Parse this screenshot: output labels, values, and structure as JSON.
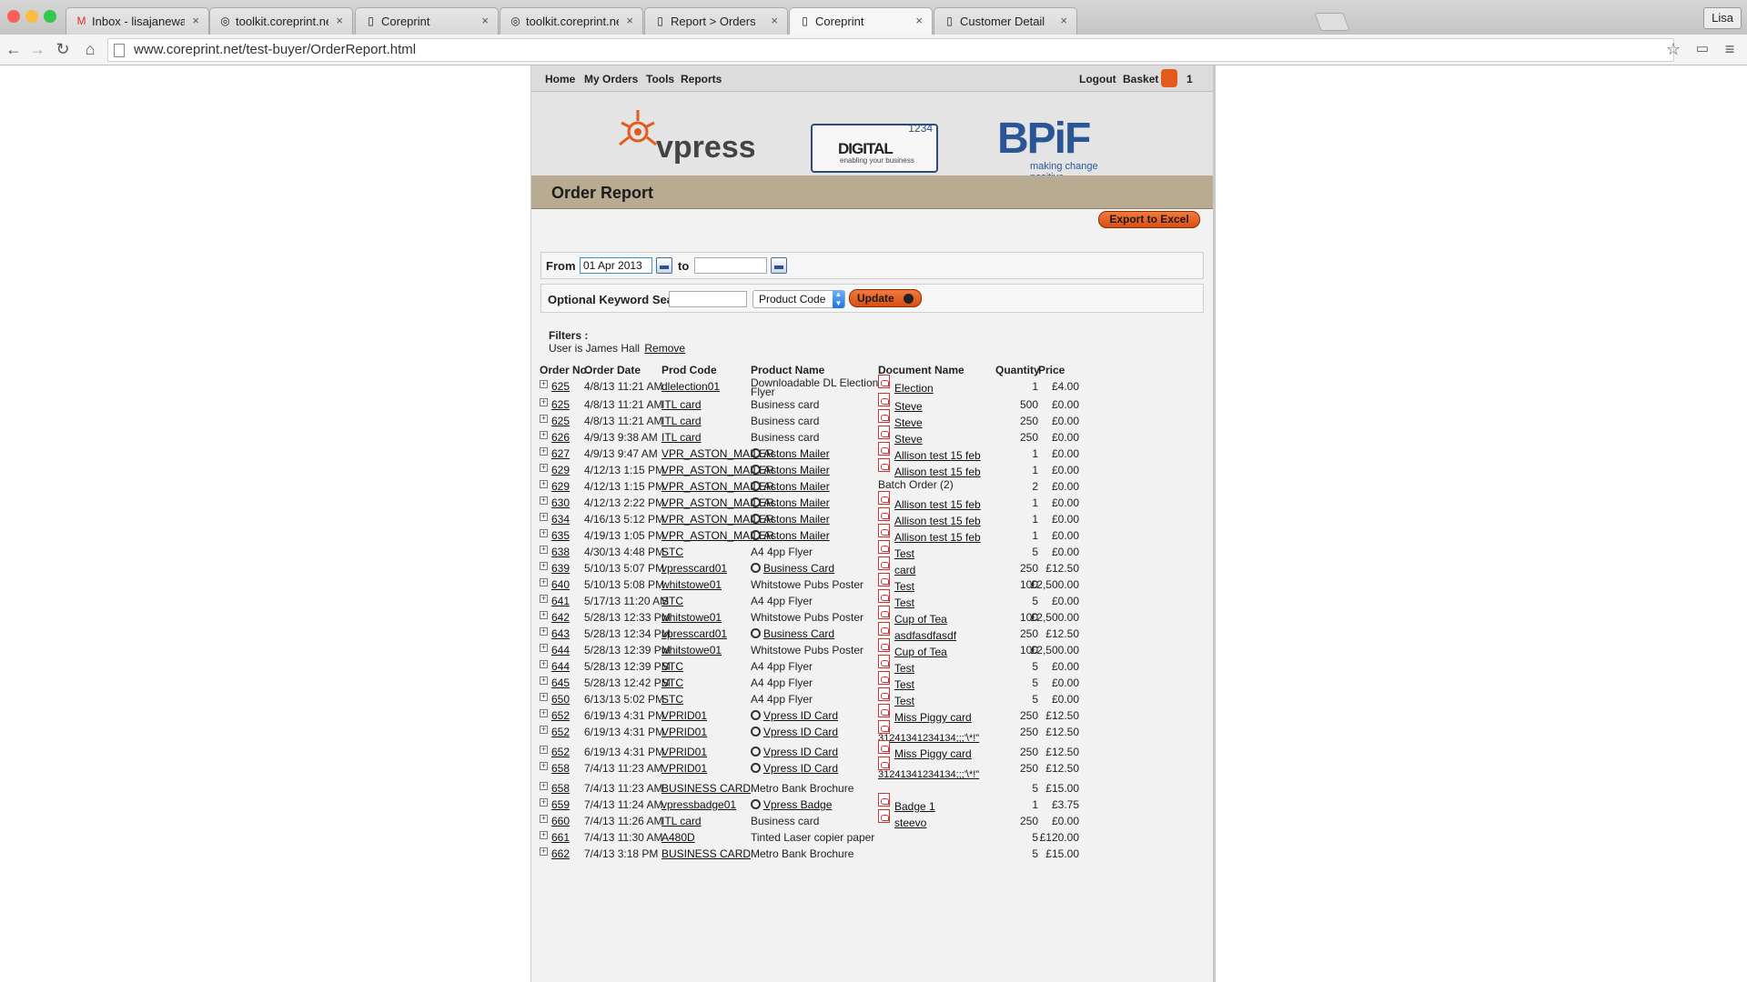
{
  "browser": {
    "tabs": [
      {
        "title": "Inbox - lisajanewarren@gm",
        "icon": "gmail-icon"
      },
      {
        "title": "toolkit.coreprint.net",
        "icon": "globe-icon"
      },
      {
        "title": "Coreprint",
        "icon": "page-icon"
      },
      {
        "title": "toolkit.coreprint.net",
        "icon": "globe-icon"
      },
      {
        "title": "Report > Orders",
        "icon": "page-icon"
      },
      {
        "title": "Coreprint",
        "icon": "page-icon"
      },
      {
        "title": "Customer Detail",
        "icon": "page-icon"
      }
    ],
    "active_tab_index": 5,
    "user": "Lisa",
    "url": "www.coreprint.net/test-buyer/OrderReport.html"
  },
  "nav": {
    "home": "Home",
    "my_orders": "My Orders",
    "tools": "Tools",
    "reports": "Reports",
    "logout": "Logout",
    "basket": "Basket",
    "basket_count": "1"
  },
  "banner": {
    "vpress": "vpress",
    "digital_num": "1234",
    "digital": "DIGITAL",
    "digital_tag": "enabling your business",
    "bpif": "BPiF",
    "bpif_tag": "making change positive"
  },
  "report": {
    "title": "Order Report",
    "export_label": "Export to Excel",
    "from_label": "From",
    "from_value": "01 Apr 2013",
    "to_label": "to",
    "to_value": "",
    "keyword_label": "Optional Keyword Search",
    "keyword_value": "",
    "search_field": "Product Code",
    "update_label": "Update",
    "filters_label": "Filters :",
    "filter_text": "User is James Hall",
    "remove_label": "Remove"
  },
  "table": {
    "headers": [
      "Order No.",
      "Order Date",
      "Prod Code",
      "Product Name",
      "Document Name",
      "Quantity",
      "Price"
    ],
    "rows": [
      {
        "no": "625",
        "date": "4/8/13 11:21 AM",
        "code": "dlelection01",
        "product": "Downloadable DL Election",
        "product2": "Flyer",
        "doc": "Election",
        "qty": "1",
        "price": "£4.00"
      },
      {
        "no": "625",
        "date": "4/8/13 11:21 AM",
        "code": "ITL card",
        "product": "Business card",
        "doc": "Steve",
        "qty": "500",
        "price": "£0.00"
      },
      {
        "no": "625",
        "date": "4/8/13 11:21 AM",
        "code": "ITL card",
        "product": "Business card",
        "doc": "Steve",
        "qty": "250",
        "price": "£0.00"
      },
      {
        "no": "626",
        "date": "4/9/13 9:38 AM",
        "code": "ITL card",
        "product": "Business card",
        "doc": "Steve",
        "qty": "250",
        "price": "£0.00"
      },
      {
        "no": "627",
        "date": "4/9/13 9:47 AM",
        "code": "VPR_ASTON_MAILER",
        "product": "Astons Mailer",
        "plink": true,
        "doc": "Allison test 15 feb",
        "qty": "1",
        "price": "£0.00"
      },
      {
        "no": "629",
        "date": "4/12/13 1:15 PM",
        "code": "VPR_ASTON_MAILER",
        "product": "Astons Mailer",
        "plink": true,
        "doc": "Allison test 15 feb",
        "qty": "1",
        "price": "£0.00"
      },
      {
        "no": "629",
        "date": "4/12/13 1:15 PM",
        "code": "VPR_ASTON_MAILER",
        "product": "Astons Mailer",
        "plink": true,
        "doc": "Batch Order (2)",
        "plaindoc": true,
        "qty": "2",
        "price": "£0.00"
      },
      {
        "no": "630",
        "date": "4/12/13 2:22 PM",
        "code": "VPR_ASTON_MAILER",
        "product": "Astons Mailer",
        "plink": true,
        "doc": "Allison test 15 feb",
        "qty": "1",
        "price": "£0.00"
      },
      {
        "no": "634",
        "date": "4/16/13 5:12 PM",
        "code": "VPR_ASTON_MAILER",
        "product": "Astons Mailer",
        "plink": true,
        "doc": "Allison test 15 feb",
        "qty": "1",
        "price": "£0.00"
      },
      {
        "no": "635",
        "date": "4/19/13 1:05 PM",
        "code": "VPR_ASTON_MAILER",
        "product": "Astons Mailer",
        "plink": true,
        "doc": "Allison test 15 feb",
        "qty": "1",
        "price": "£0.00"
      },
      {
        "no": "638",
        "date": "4/30/13 4:48 PM",
        "code": "STC",
        "product": "A4 4pp Flyer",
        "doc": "Test",
        "qty": "5",
        "price": "£0.00"
      },
      {
        "no": "639",
        "date": "5/10/13 5:07 PM",
        "code": "vpresscard01",
        "product": "Business Card",
        "plink": true,
        "doc": "card",
        "qty": "250",
        "price": "£12.50"
      },
      {
        "no": "640",
        "date": "5/10/13 5:08 PM",
        "code": "whitstowe01",
        "product": "Whitstowe Pubs Poster",
        "doc": "Test",
        "qty": "100",
        "price": "£2,500.00"
      },
      {
        "no": "641",
        "date": "5/17/13 11:20 AM",
        "code": "STC",
        "product": "A4 4pp Flyer",
        "doc": "Test",
        "qty": "5",
        "price": "£0.00"
      },
      {
        "no": "642",
        "date": "5/28/13 12:33 PM",
        "code": "whitstowe01",
        "product": "Whitstowe Pubs Poster",
        "doc": "Cup of Tea",
        "qty": "100",
        "price": "£2,500.00"
      },
      {
        "no": "643",
        "date": "5/28/13 12:34 PM",
        "code": "vpresscard01",
        "product": "Business Card",
        "plink": true,
        "doc": "asdfasdfasdf",
        "qty": "250",
        "price": "£12.50"
      },
      {
        "no": "644",
        "date": "5/28/13 12:39 PM",
        "code": "whitstowe01",
        "product": "Whitstowe Pubs Poster",
        "doc": "Cup of Tea",
        "qty": "100",
        "price": "£2,500.00"
      },
      {
        "no": "644",
        "date": "5/28/13 12:39 PM",
        "code": "STC",
        "product": "A4 4pp Flyer",
        "doc": "Test",
        "qty": "5",
        "price": "£0.00"
      },
      {
        "no": "645",
        "date": "5/28/13 12:42 PM",
        "code": "STC",
        "product": "A4 4pp Flyer",
        "doc": "Test",
        "qty": "5",
        "price": "£0.00"
      },
      {
        "no": "650",
        "date": "6/13/13 5:02 PM",
        "code": "STC",
        "product": "A4 4pp Flyer",
        "doc": "Test",
        "qty": "5",
        "price": "£0.00"
      },
      {
        "no": "652",
        "date": "6/19/13 4:31 PM",
        "code": "VPRID01",
        "product": "Vpress ID Card",
        "plink": true,
        "doc": "Miss Piggy card",
        "qty": "250",
        "price": "£12.50"
      },
      {
        "no": "652",
        "date": "6/19/13 4:31 PM",
        "code": "VPRID01",
        "product": "Vpress ID Card",
        "plink": true,
        "doc": "31241341234134;;;'\\*!\"",
        "wrapdoc": true,
        "qty": "250",
        "price": "£12.50"
      },
      {
        "no": "652",
        "date": "6/19/13 4:31 PM",
        "code": "VPRID01",
        "product": "Vpress ID Card",
        "plink": true,
        "doc": "Miss Piggy card",
        "qty": "250",
        "price": "£12.50"
      },
      {
        "no": "658",
        "date": "7/4/13 11:23 AM",
        "code": "VPRID01",
        "product": "Vpress ID Card",
        "plink": true,
        "doc": "31241341234134;;;'\\*!\"",
        "wrapdoc": true,
        "qty": "250",
        "price": "£12.50"
      },
      {
        "no": "658",
        "date": "7/4/13 11:23 AM",
        "code": "BUSINESS CARD",
        "product": "Metro Bank Brochure",
        "doc": "",
        "qty": "5",
        "price": "£15.00"
      },
      {
        "no": "659",
        "date": "7/4/13 11:24 AM",
        "code": "vpressbadge01",
        "product": "Vpress Badge",
        "plink": true,
        "doc": "Badge 1",
        "qty": "1",
        "price": "£3.75"
      },
      {
        "no": "660",
        "date": "7/4/13 11:26 AM",
        "code": "ITL card",
        "product": "Business card",
        "doc": "steevo",
        "qty": "250",
        "price": "£0.00"
      },
      {
        "no": "661",
        "date": "7/4/13 11:30 AM",
        "code": "A480D",
        "product": "Tinted Laser copier paper",
        "doc": "",
        "qty": "5",
        "price": "£120.00"
      },
      {
        "no": "662",
        "date": "7/4/13 3:18 PM",
        "code": "BUSINESS CARD",
        "product": "Metro Bank Brochure",
        "doc": "",
        "qty": "5",
        "price": "£15.00"
      }
    ]
  }
}
